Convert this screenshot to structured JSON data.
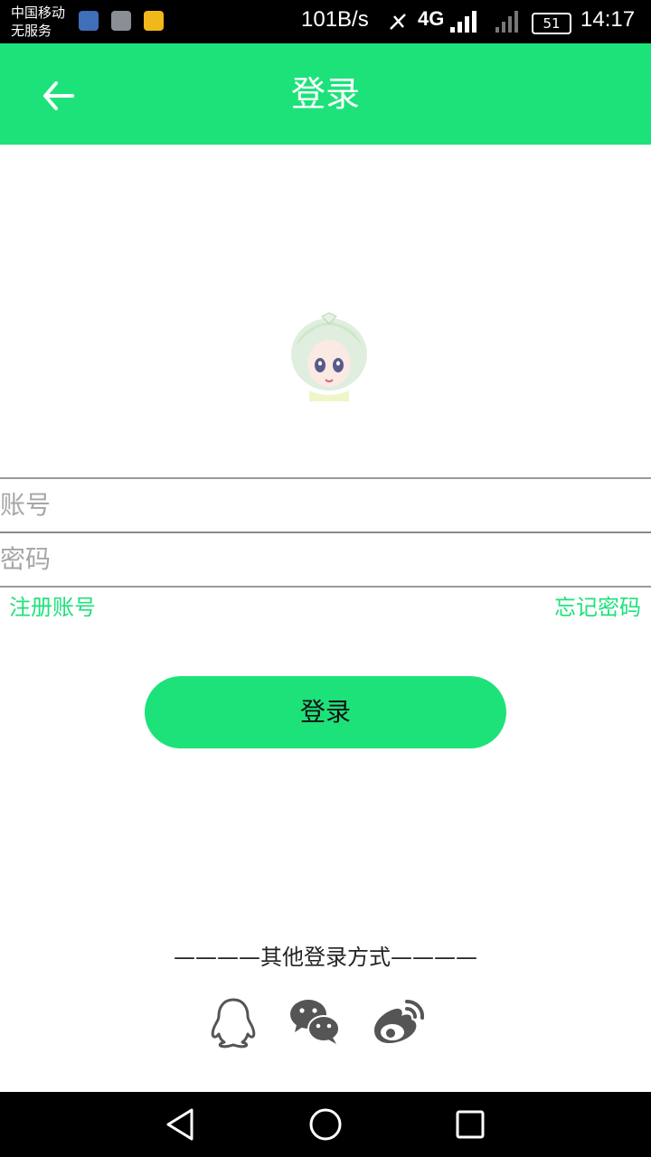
{
  "status_bar": {
    "carrier_line1": "中国移动",
    "carrier_line2": "无服务",
    "speed": "101B/s",
    "network": "4G",
    "battery": "51",
    "time": "14:17"
  },
  "app_bar": {
    "title": "登录",
    "back_icon": "arrow-left-icon"
  },
  "form": {
    "account_placeholder": "账号",
    "password_placeholder": "密码",
    "register_label": "注册账号",
    "forgot_label": "忘记密码",
    "login_label": "登录"
  },
  "other_login": {
    "label": "————其他登录方式————",
    "icons": [
      "qq-icon",
      "wechat-icon",
      "weibo-icon"
    ]
  },
  "colors": {
    "accent": "#1de27a",
    "status_bar": "#000000",
    "nav_bar": "#000000"
  }
}
